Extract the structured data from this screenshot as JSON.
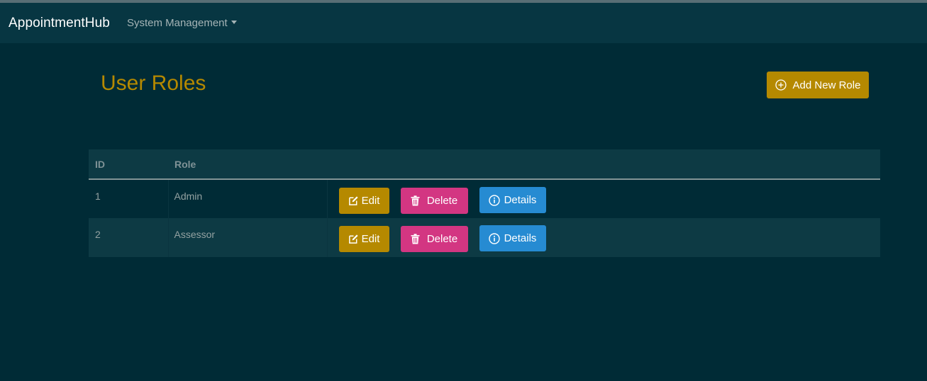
{
  "navbar": {
    "brand": "AppointmentHub",
    "menu_label": "System Management"
  },
  "page": {
    "title": "User Roles",
    "add_button_label": "Add New Role"
  },
  "table": {
    "headers": {
      "id": "ID",
      "role": "Role",
      "actions": ""
    },
    "rows": [
      {
        "id": "1",
        "role": "Admin"
      },
      {
        "id": "2",
        "role": "Assessor"
      }
    ],
    "actions": {
      "edit": "Edit",
      "delete": "Delete",
      "details": "Details"
    }
  },
  "colors": {
    "background": "#002b36",
    "navbar": "#073642",
    "title": "#b58900",
    "edit": "#b58900",
    "delete": "#d33682",
    "details": "#268bd2"
  },
  "icons": {
    "add": "plus-circle-icon",
    "edit": "pencil-square-icon",
    "delete": "trash-icon",
    "details": "info-circle-icon",
    "menu": "caret-down-icon"
  }
}
